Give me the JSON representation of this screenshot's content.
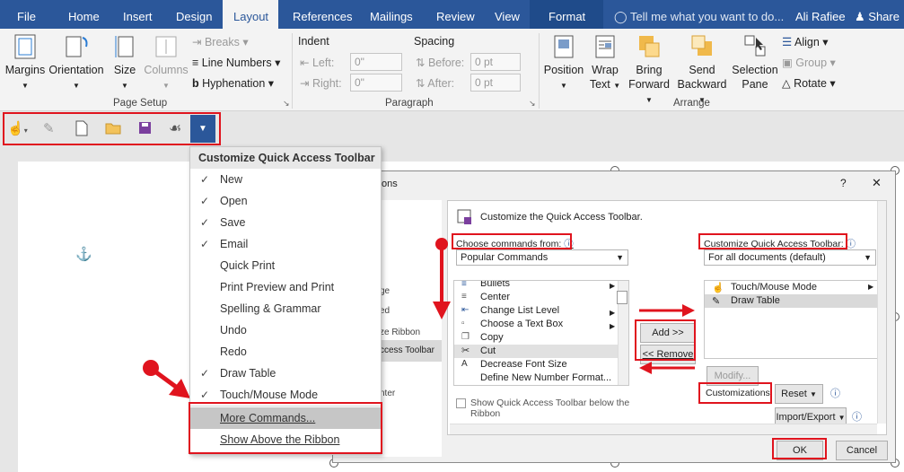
{
  "tabs": [
    {
      "label": "File"
    },
    {
      "label": "Home"
    },
    {
      "label": "Insert"
    },
    {
      "label": "Design"
    },
    {
      "label": "Layout"
    },
    {
      "label": "References"
    },
    {
      "label": "Mailings"
    },
    {
      "label": "Review"
    },
    {
      "label": "View"
    },
    {
      "label": "Format"
    }
  ],
  "tell_me": "Tell me what you want to do...",
  "user": "Ali Rafiee",
  "share": "Share",
  "page_setup": {
    "margins": "Margins",
    "orientation": "Orientation",
    "size": "Size",
    "columns": "Columns",
    "breaks": "Breaks",
    "line_numbers": "Line Numbers",
    "hyphenation": "Hyphenation",
    "label": "Page Setup"
  },
  "paragraph": {
    "indent": "Indent",
    "spacing": "Spacing",
    "left": "Left:",
    "right": "Right:",
    "before": "Before:",
    "after": "After:",
    "left_val": "0\"",
    "right_val": "0\"",
    "before_val": "0 pt",
    "after_val": "0 pt",
    "label": "Paragraph"
  },
  "arrange": {
    "position": "Position",
    "wrap1": "Wrap",
    "wrap2": "Text",
    "bring1": "Bring",
    "bring2": "Forward",
    "send1": "Send",
    "send2": "Backward",
    "sel1": "Selection",
    "sel2": "Pane",
    "align": "Align",
    "group": "Group",
    "rotate": "Rotate",
    "label": "Arrange"
  },
  "qat_menu": {
    "title": "Customize Quick Access Toolbar",
    "items": [
      {
        "label": "New"
      },
      {
        "label": "Open"
      },
      {
        "label": "Save"
      },
      {
        "label": "Email"
      },
      {
        "label": "Quick Print"
      },
      {
        "label": "Print Preview and Print"
      },
      {
        "label": "Spelling & Grammar"
      },
      {
        "label": "Undo"
      },
      {
        "label": "Redo"
      },
      {
        "label": "Draw Table"
      },
      {
        "label": "Touch/Mouse Mode"
      },
      {
        "label": "More Commands..."
      },
      {
        "label": "Show Above the Ribbon"
      }
    ]
  },
  "dialog": {
    "title_fragment": "ons",
    "help": "?",
    "close": "✕",
    "left_fragments": [
      "ge",
      "ed",
      "ze Ribbon",
      "ccess Toolbar",
      "nter"
    ],
    "heading": "Customize the Quick Access Toolbar.",
    "choose_label": "Choose commands from:",
    "choose_value": "Popular Commands",
    "custom_label": "Customize Quick Access Toolbar:",
    "custom_value": "For all documents (default)",
    "commands": [
      {
        "label": "Bullets"
      },
      {
        "label": "Center"
      },
      {
        "label": "Change List Level"
      },
      {
        "label": "Choose a Text Box"
      },
      {
        "label": "Copy"
      },
      {
        "label": "Cut"
      },
      {
        "label": "Decrease Font Size"
      },
      {
        "label": "Define New Number Format..."
      }
    ],
    "right_items": [
      {
        "label": "Touch/Mouse Mode"
      },
      {
        "label": "Draw Table"
      }
    ],
    "add": "Add >>",
    "remove": "<< Remove",
    "modify": "Modify...",
    "customizations": "Customizations:",
    "reset": "Reset",
    "import_export": "Import/Export",
    "show_below": "Show Quick Access Toolbar below the",
    "show_below2": "Ribbon",
    "ok": "OK",
    "cancel": "Cancel"
  },
  "colors": {
    "accent": "#2b579a",
    "highlight_red": "#e0141e"
  },
  "icons": [
    "touch-mode-icon",
    "draw-table-icon",
    "new-doc-icon",
    "open-folder-icon",
    "save-icon",
    "attach-icon",
    "customize-dropdown-icon",
    "anchor-icon",
    "help-icon",
    "close-icon",
    "info-icon"
  ]
}
